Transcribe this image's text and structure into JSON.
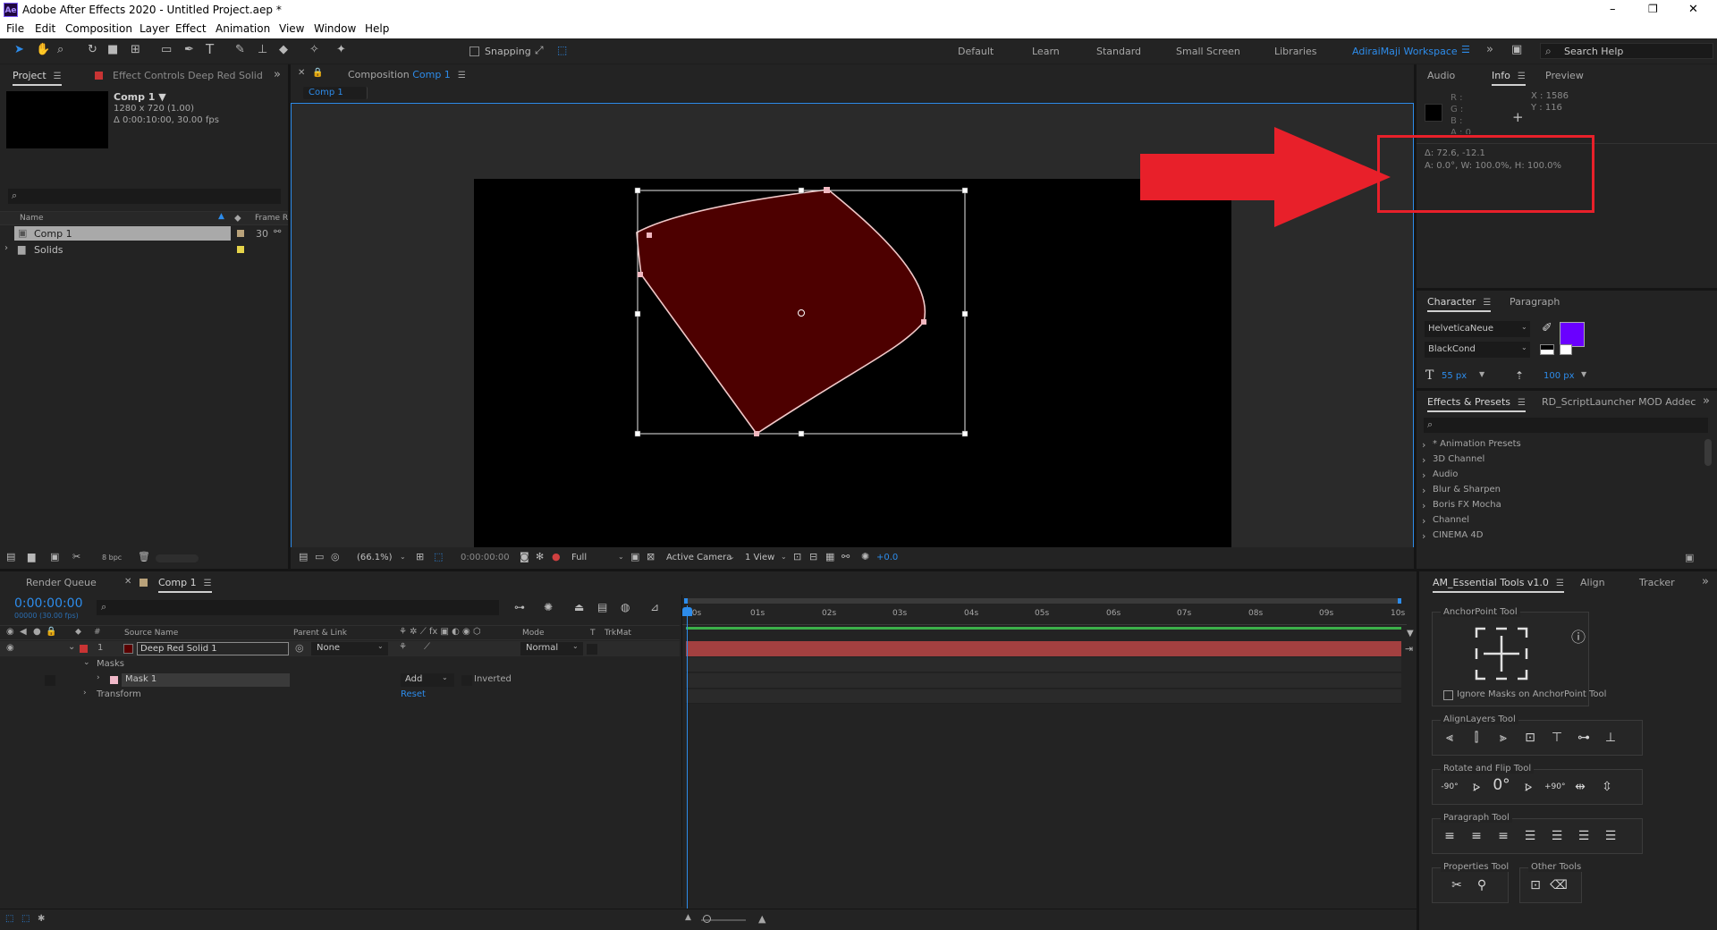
{
  "window": {
    "title": "Adobe After Effects 2020 - Untitled Project.aep *",
    "app_icon": "Ae",
    "controls": [
      "–",
      "❐",
      "✕"
    ]
  },
  "menu": [
    "File",
    "Edit",
    "Composition",
    "Layer",
    "Effect",
    "Animation",
    "View",
    "Window",
    "Help"
  ],
  "toolbar": {
    "snapping_label": "Snapping",
    "workspaces": [
      "Default",
      "Learn",
      "Standard",
      "Small Screen",
      "Libraries",
      "AdiraiMaji Workspace"
    ],
    "active_workspace": "AdiraiMaji Workspace",
    "search_help": "Search Help"
  },
  "project_panel": {
    "tab_project": "Project",
    "tab_effect_controls": "Effect Controls Deep Red Solid",
    "comp_name": "Comp 1 ▼",
    "comp_size": "1280 x 720 (1.00)",
    "comp_duration": "Δ 0:00:10:00, 30.00 fps",
    "search_placeholder": "⌕",
    "col_name": "Name",
    "col_frame_rate": "Frame R.",
    "items": [
      {
        "name": "Comp 1",
        "rate": "30",
        "label_color": "#b9a27a"
      },
      {
        "name": "Solids",
        "rate": "",
        "label_color": "#e6d44a"
      }
    ],
    "bpc": "8 bpc"
  },
  "composition_panel": {
    "tab_prefix": "Composition",
    "tab_comp": "Comp 1",
    "breadcrumb": "Comp 1",
    "zoom": "(66.1%)",
    "timecode": "0:00:00:00",
    "resolution": "Full",
    "camera": "Active Camera",
    "view": "1 View",
    "exposure": "+0.0"
  },
  "info_panel": {
    "tabs": [
      "Audio",
      "Info",
      "Preview"
    ],
    "r": "R :",
    "g": "G :",
    "b": "B :",
    "a": "A : 0",
    "x": "X : 1586",
    "y": "Y : 116",
    "delta": "Δ: 72.6, -12.1",
    "transform": "A: 0.0°, W: 100.0%, H: 100.0%"
  },
  "character_panel": {
    "tabs": [
      "Character",
      "Paragraph"
    ],
    "font": "HelveticaNeue",
    "style": "BlackCond",
    "size": "55 px",
    "tracking": "100 px",
    "fill_color": "#6a00ff"
  },
  "effects_panel": {
    "tabs": [
      "Effects & Presets",
      "RD_ScriptLauncher MOD Addec"
    ],
    "items": [
      "* Animation Presets",
      "3D Channel",
      "Audio",
      "Blur & Sharpen",
      "Boris FX Mocha",
      "Channel",
      "CINEMA 4D"
    ]
  },
  "timeline": {
    "tab_render_queue": "Render Queue",
    "tab_comp": "Comp 1",
    "timecode": "0:00:00:00",
    "fps_sub": "00000 (30.00 fps)",
    "col_source_name": "Source Name",
    "col_parent": "Parent & Link",
    "col_mode": "Mode",
    "col_t": "T",
    "col_trkmat": "TrkMat",
    "layer_index": "1",
    "layer_name": "Deep Red Solid 1",
    "layer_parent": "None",
    "layer_mode": "Normal",
    "masks_label": "Masks",
    "mask_name": "Mask 1",
    "mask_mode": "Add",
    "mask_inverted": "Inverted",
    "transform_label": "Transform",
    "reset_label": "Reset",
    "ruler": [
      "00s",
      "01s",
      "02s",
      "03s",
      "04s",
      "05s",
      "06s",
      "07s",
      "08s",
      "09s",
      "10s"
    ]
  },
  "essential_tools": {
    "tabs": [
      "AM_Essential Tools v1.0",
      "Align",
      "Tracker"
    ],
    "anchorpoint_title": "AnchorPoint Tool",
    "ignore_masks": "Ignore Masks on AnchorPoint Tool",
    "align_title": "AlignLayers Tool",
    "rotate_title": "Rotate and Flip Tool",
    "rotate_labels": [
      "-90°",
      "0°",
      "+90°"
    ],
    "paragraph_title": "Paragraph Tool",
    "properties_title": "Properties Tool",
    "other_title": "Other Tools"
  }
}
